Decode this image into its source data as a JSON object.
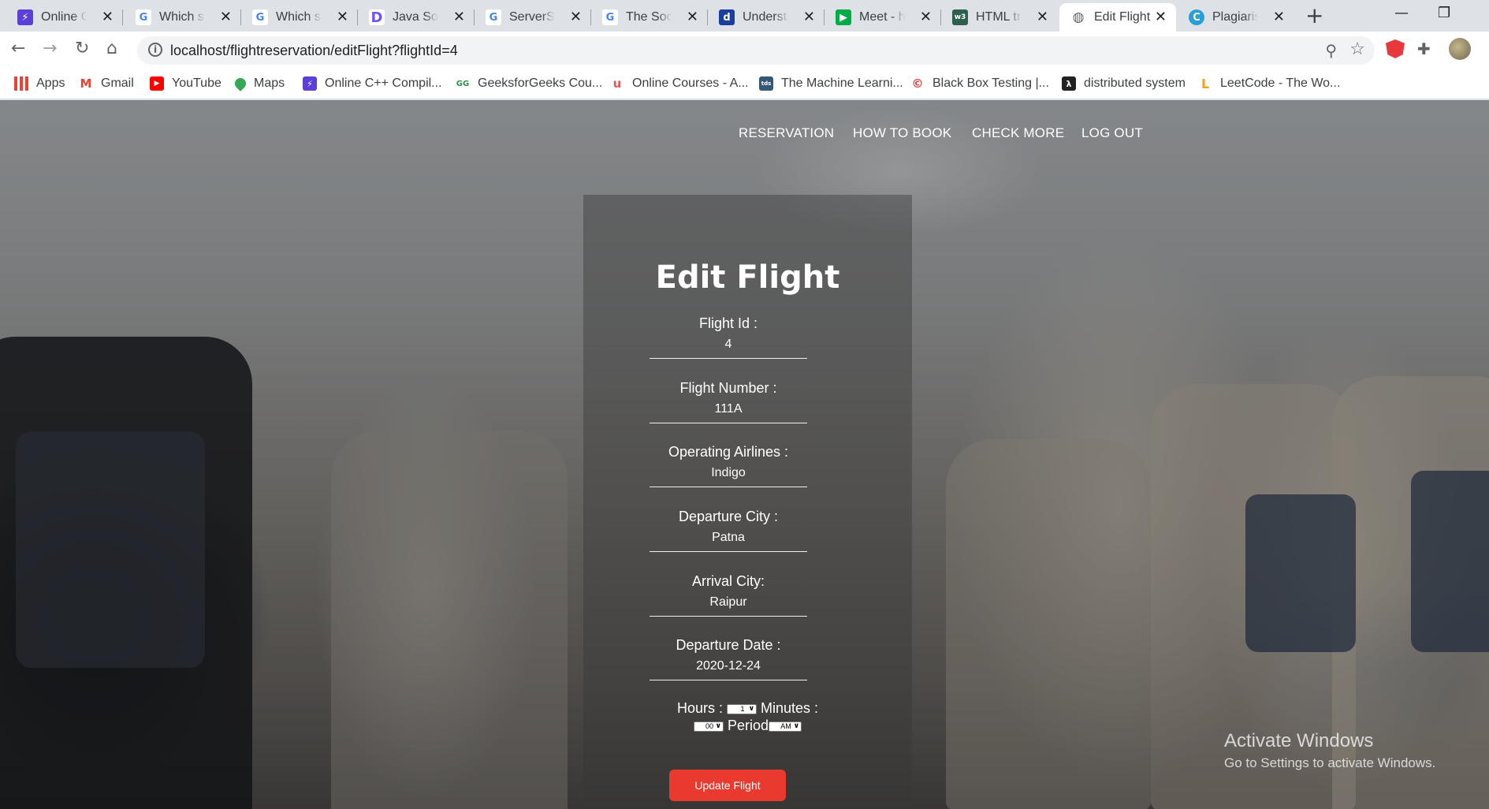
{
  "browser": {
    "tabs": [
      {
        "title": "Online C++",
        "favicon": "bolt-icon",
        "color": "#5b3fd6",
        "active": false
      },
      {
        "title": "Which sta",
        "favicon": "google-icon",
        "color": "#4285f4",
        "active": false
      },
      {
        "title": "Which sta",
        "favicon": "google-icon",
        "color": "#4285f4",
        "active": false
      },
      {
        "title": "Java Socke",
        "favicon": "dev-icon",
        "color": "#6f52ff",
        "active": false
      },
      {
        "title": "ServerSoc",
        "favicon": "google-icon",
        "color": "#4285f4",
        "active": false
      },
      {
        "title": "The Socke",
        "favicon": "google-icon",
        "color": "#4285f4",
        "active": false
      },
      {
        "title": "Understan",
        "favicon": "site-icon",
        "color": "#1a3f9e",
        "active": false
      },
      {
        "title": "Meet - hz",
        "favicon": "meet-icon",
        "color": "#00ac47",
        "active": false
      },
      {
        "title": "HTML tr T",
        "favicon": "w3-icon",
        "color": "#2d5f4f",
        "active": false
      },
      {
        "title": "Edit Flight",
        "favicon": "globe-icon",
        "color": "#5f6368",
        "active": true
      },
      {
        "title": "Plagiarism",
        "favicon": "checker-icon",
        "color": "#2a9fd6",
        "active": false
      }
    ],
    "new_tab": "+",
    "window_controls": {
      "minimize": "—",
      "restore": "❐"
    },
    "url": "localhost/flightreservation/editFlight?flightId=4",
    "bookmarks": [
      {
        "label": "Apps",
        "icon": "apps-grid-icon",
        "color": "#4285f4"
      },
      {
        "label": "Gmail",
        "icon": "gmail-icon",
        "color": "#ea4335"
      },
      {
        "label": "YouTube",
        "icon": "youtube-icon",
        "color": "#ff0000"
      },
      {
        "label": "Maps",
        "icon": "maps-pin-icon",
        "color": "#34a853"
      },
      {
        "label": "Online C++ Compil...",
        "icon": "bolt-icon",
        "color": "#5b3fd6"
      },
      {
        "label": "GeeksforGeeks Cou...",
        "icon": "gfg-icon",
        "color": "#2f8d46"
      },
      {
        "label": "Online Courses - A...",
        "icon": "udemy-icon",
        "color": "#ec5252"
      },
      {
        "label": "The Machine Learni...",
        "icon": "tds-icon",
        "color": "#355876"
      },
      {
        "label": "Black Box Testing |...",
        "icon": "guru-icon",
        "color": "#e53935"
      },
      {
        "label": "distributed system",
        "icon": "lambda-icon",
        "color": "#222222"
      },
      {
        "label": "LeetCode - The Wo...",
        "icon": "leetcode-icon",
        "color": "#f89f1b"
      }
    ]
  },
  "nav": {
    "items": [
      "RESERVATION",
      "HOW TO BOOK",
      "CHECK MORE",
      "LOG OUT"
    ]
  },
  "form": {
    "title": "Edit Flight",
    "fields": [
      {
        "label": "Flight Id :",
        "value": "4"
      },
      {
        "label": "Flight Number :",
        "value": "111A"
      },
      {
        "label": "Operating Airlines :",
        "value": "Indigo"
      },
      {
        "label": "Departure City :",
        "value": "Patna"
      },
      {
        "label": "Arrival City:",
        "value": "Raipur"
      },
      {
        "label": "Departure Date :",
        "value": "2020-12-24"
      }
    ],
    "time": {
      "hours_label": "Hours :",
      "hours_value": "1",
      "minutes_label": "Minutes :",
      "minutes_value": "00",
      "period_label": "Period",
      "period_value": "AM"
    },
    "submit_label": "Update Flight"
  },
  "watermark": {
    "line1": "Activate Windows",
    "line2": "Go to Settings to activate Windows."
  }
}
